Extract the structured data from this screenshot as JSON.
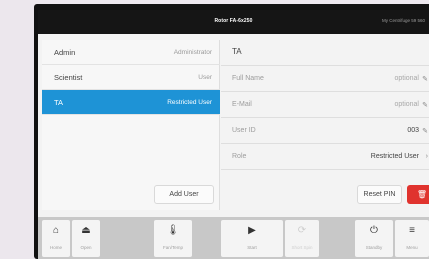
{
  "header": {
    "title": "Rotor FA-6x250",
    "status": "My Centrifuge 59 560"
  },
  "users": [
    {
      "name": "Admin",
      "role": "Administrator",
      "selected": false
    },
    {
      "name": "Scientist",
      "role": "User",
      "selected": false
    },
    {
      "name": "TA",
      "role": "Restricted User",
      "selected": true
    }
  ],
  "add_user_label": "Add User",
  "detail": {
    "heading": "TA",
    "fields": [
      {
        "label": "Full Name",
        "value": "optional"
      },
      {
        "label": "E-Mail",
        "value": "optional"
      },
      {
        "label": "User ID",
        "value": "003"
      },
      {
        "label": "Role",
        "value": "Restricted User"
      }
    ],
    "reset_pin_label": "Reset PIN",
    "delete_icon": "trash-icon"
  },
  "nav": [
    {
      "label": "Home",
      "icon": "home-icon",
      "glyph": "⌂"
    },
    {
      "label": "Open",
      "icon": "open-lid-icon",
      "glyph": "⏏"
    },
    {
      "label": "Fan/Temp",
      "icon": "thermometer-icon",
      "glyph": "🌡"
    },
    {
      "label": "Start",
      "icon": "play-icon",
      "glyph": "▶"
    },
    {
      "label": "Short Spin",
      "icon": "spin-icon",
      "glyph": "⟳"
    },
    {
      "label": "Standby",
      "icon": "power-icon",
      "glyph": "⏻"
    },
    {
      "label": "Menu",
      "icon": "menu-icon",
      "glyph": "≡"
    }
  ],
  "colors": {
    "accent": "#1e93d6",
    "danger": "#e0332e"
  }
}
